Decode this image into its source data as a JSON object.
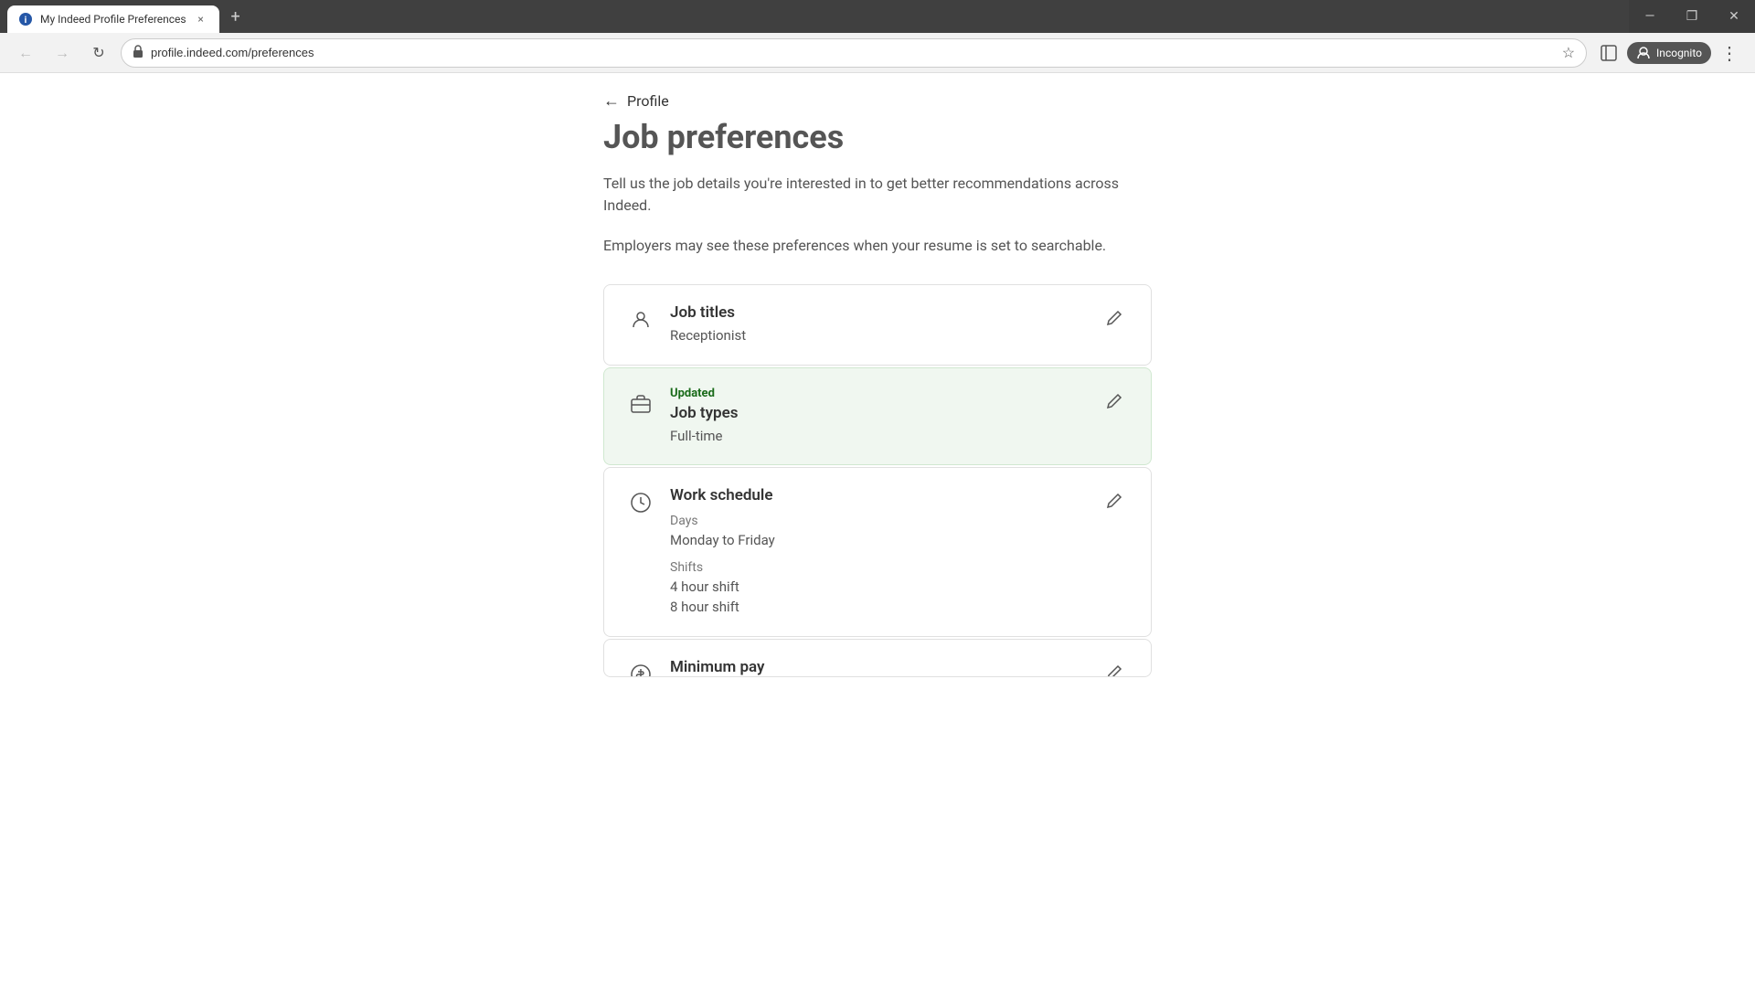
{
  "browser": {
    "tab": {
      "favicon_label": "i",
      "title": "My Indeed Profile Preferences",
      "close_label": "×"
    },
    "new_tab_label": "+",
    "window_controls": {
      "minimize": "—",
      "maximize": "❐",
      "close": "✕"
    },
    "nav": {
      "back_disabled": true,
      "forward_disabled": true,
      "refresh_label": "↻",
      "url": "profile.indeed.com/preferences",
      "bookmark_label": "☆",
      "sidebar_label": "▣",
      "incognito_label": "Incognito",
      "more_label": "⋮"
    }
  },
  "page": {
    "back_link_label": "Profile",
    "page_heading_partial": "Job preferences",
    "description": "Tell us the job details you're interested in to get better recommendations across Indeed.",
    "employer_note": "Employers may see these preferences when your resume is set to searchable.",
    "preferences": [
      {
        "id": "job-titles",
        "icon_type": "person",
        "updated": false,
        "title": "Job titles",
        "values": [
          "Receptionist"
        ],
        "sub_sections": []
      },
      {
        "id": "job-types",
        "icon_type": "briefcase",
        "updated": true,
        "updated_label": "Updated",
        "title": "Job types",
        "values": [
          "Full-time"
        ],
        "sub_sections": []
      },
      {
        "id": "work-schedule",
        "icon_type": "clock",
        "updated": false,
        "title": "Work schedule",
        "values": [],
        "sub_sections": [
          {
            "label": "Days",
            "values": [
              "Monday to Friday"
            ]
          },
          {
            "label": "Shifts",
            "values": [
              "4 hour shift",
              "8 hour shift"
            ]
          }
        ]
      },
      {
        "id": "minimum-pay",
        "icon_type": "money",
        "updated": false,
        "title": "Minimum pay",
        "values": [],
        "sub_sections": []
      }
    ]
  },
  "colors": {
    "updated_bg": "#f0f7f0",
    "updated_border": "#4caf50",
    "updated_text": "#1a6b1a"
  }
}
